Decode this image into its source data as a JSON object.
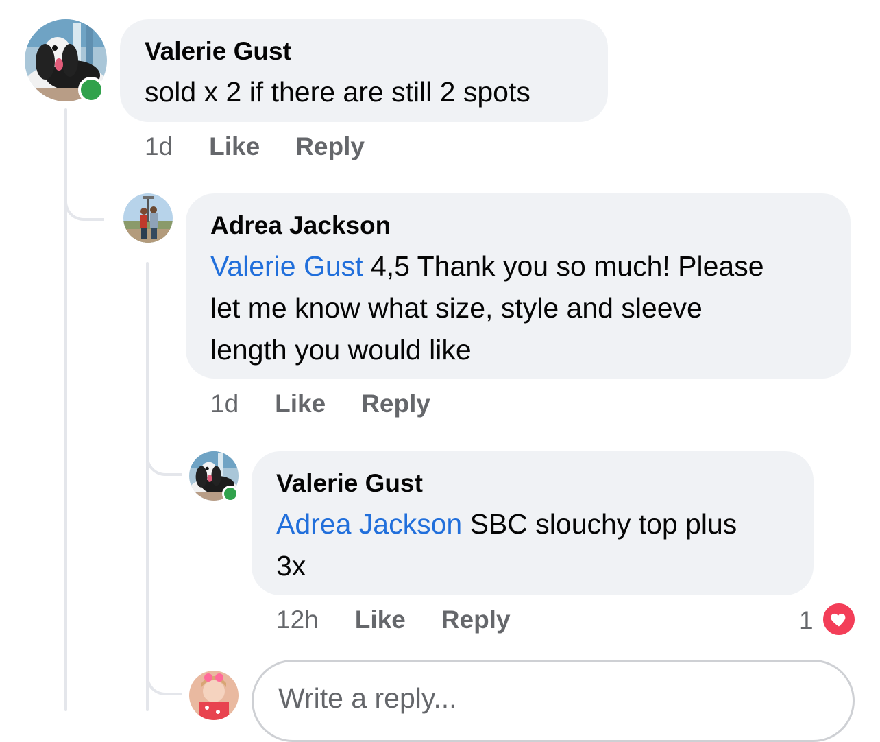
{
  "comments": [
    {
      "author": "Valerie Gust",
      "text": "sold x 2 if there are still 2 spots",
      "time": "1d",
      "like_label": "Like",
      "reply_label": "Reply"
    },
    {
      "author": "Adrea Jackson",
      "mention": "Valerie Gust",
      "text_line1": " 4,5 Thank you so much! Please",
      "text_line2": "let me know what size, style and sleeve",
      "text_line3": "length you would like",
      "time": "1d",
      "like_label": "Like",
      "reply_label": "Reply"
    },
    {
      "author": "Valerie Gust",
      "mention": "Adrea Jackson",
      "text_line1": " SBC slouchy top plus",
      "text_line2": "3x",
      "time": "12h",
      "like_label": "Like",
      "reply_label": "Reply",
      "reaction_count": "1",
      "reaction_icon": "heart-icon"
    }
  ],
  "reply_box": {
    "placeholder": "Write a reply..."
  },
  "colors": {
    "bubble": "#f0f2f5",
    "mention": "#216fdb",
    "meta": "#65676b",
    "presence": "#31a24c",
    "heart": "#f33e58"
  }
}
